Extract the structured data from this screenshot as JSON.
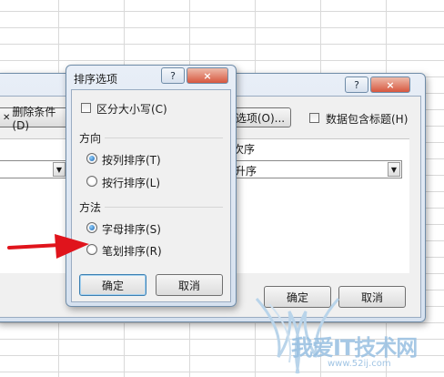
{
  "sort_dialog": {
    "help": "?",
    "close": "×",
    "delete_condition": "删除条件(D)",
    "options": "选项(O)...",
    "has_header": "数据包含标题(H)",
    "order_header": "次序",
    "order_value": "升序",
    "ok": "确定",
    "cancel": "取消"
  },
  "options_dialog": {
    "title": "排序选项",
    "help": "?",
    "close": "×",
    "case_sensitive": "区分大小写(C)",
    "direction_label": "方向",
    "by_column": "按列排序(T)",
    "by_row": "按行排序(L)",
    "method_label": "方法",
    "by_letter": "字母排序(S)",
    "by_stroke": "笔划排序(R)",
    "ok": "确定",
    "cancel": "取消"
  },
  "state": {
    "direction_selected": "by_column",
    "method_selected": "by_letter",
    "case_sensitive_checked": false,
    "has_header_checked": false
  },
  "watermark": {
    "cn": "我爱IT技术网",
    "url": "www.52ij.com"
  },
  "colors": {
    "arrow": "#e0141c",
    "frame": "#d6e1ef",
    "client": "#f0f0f0"
  }
}
